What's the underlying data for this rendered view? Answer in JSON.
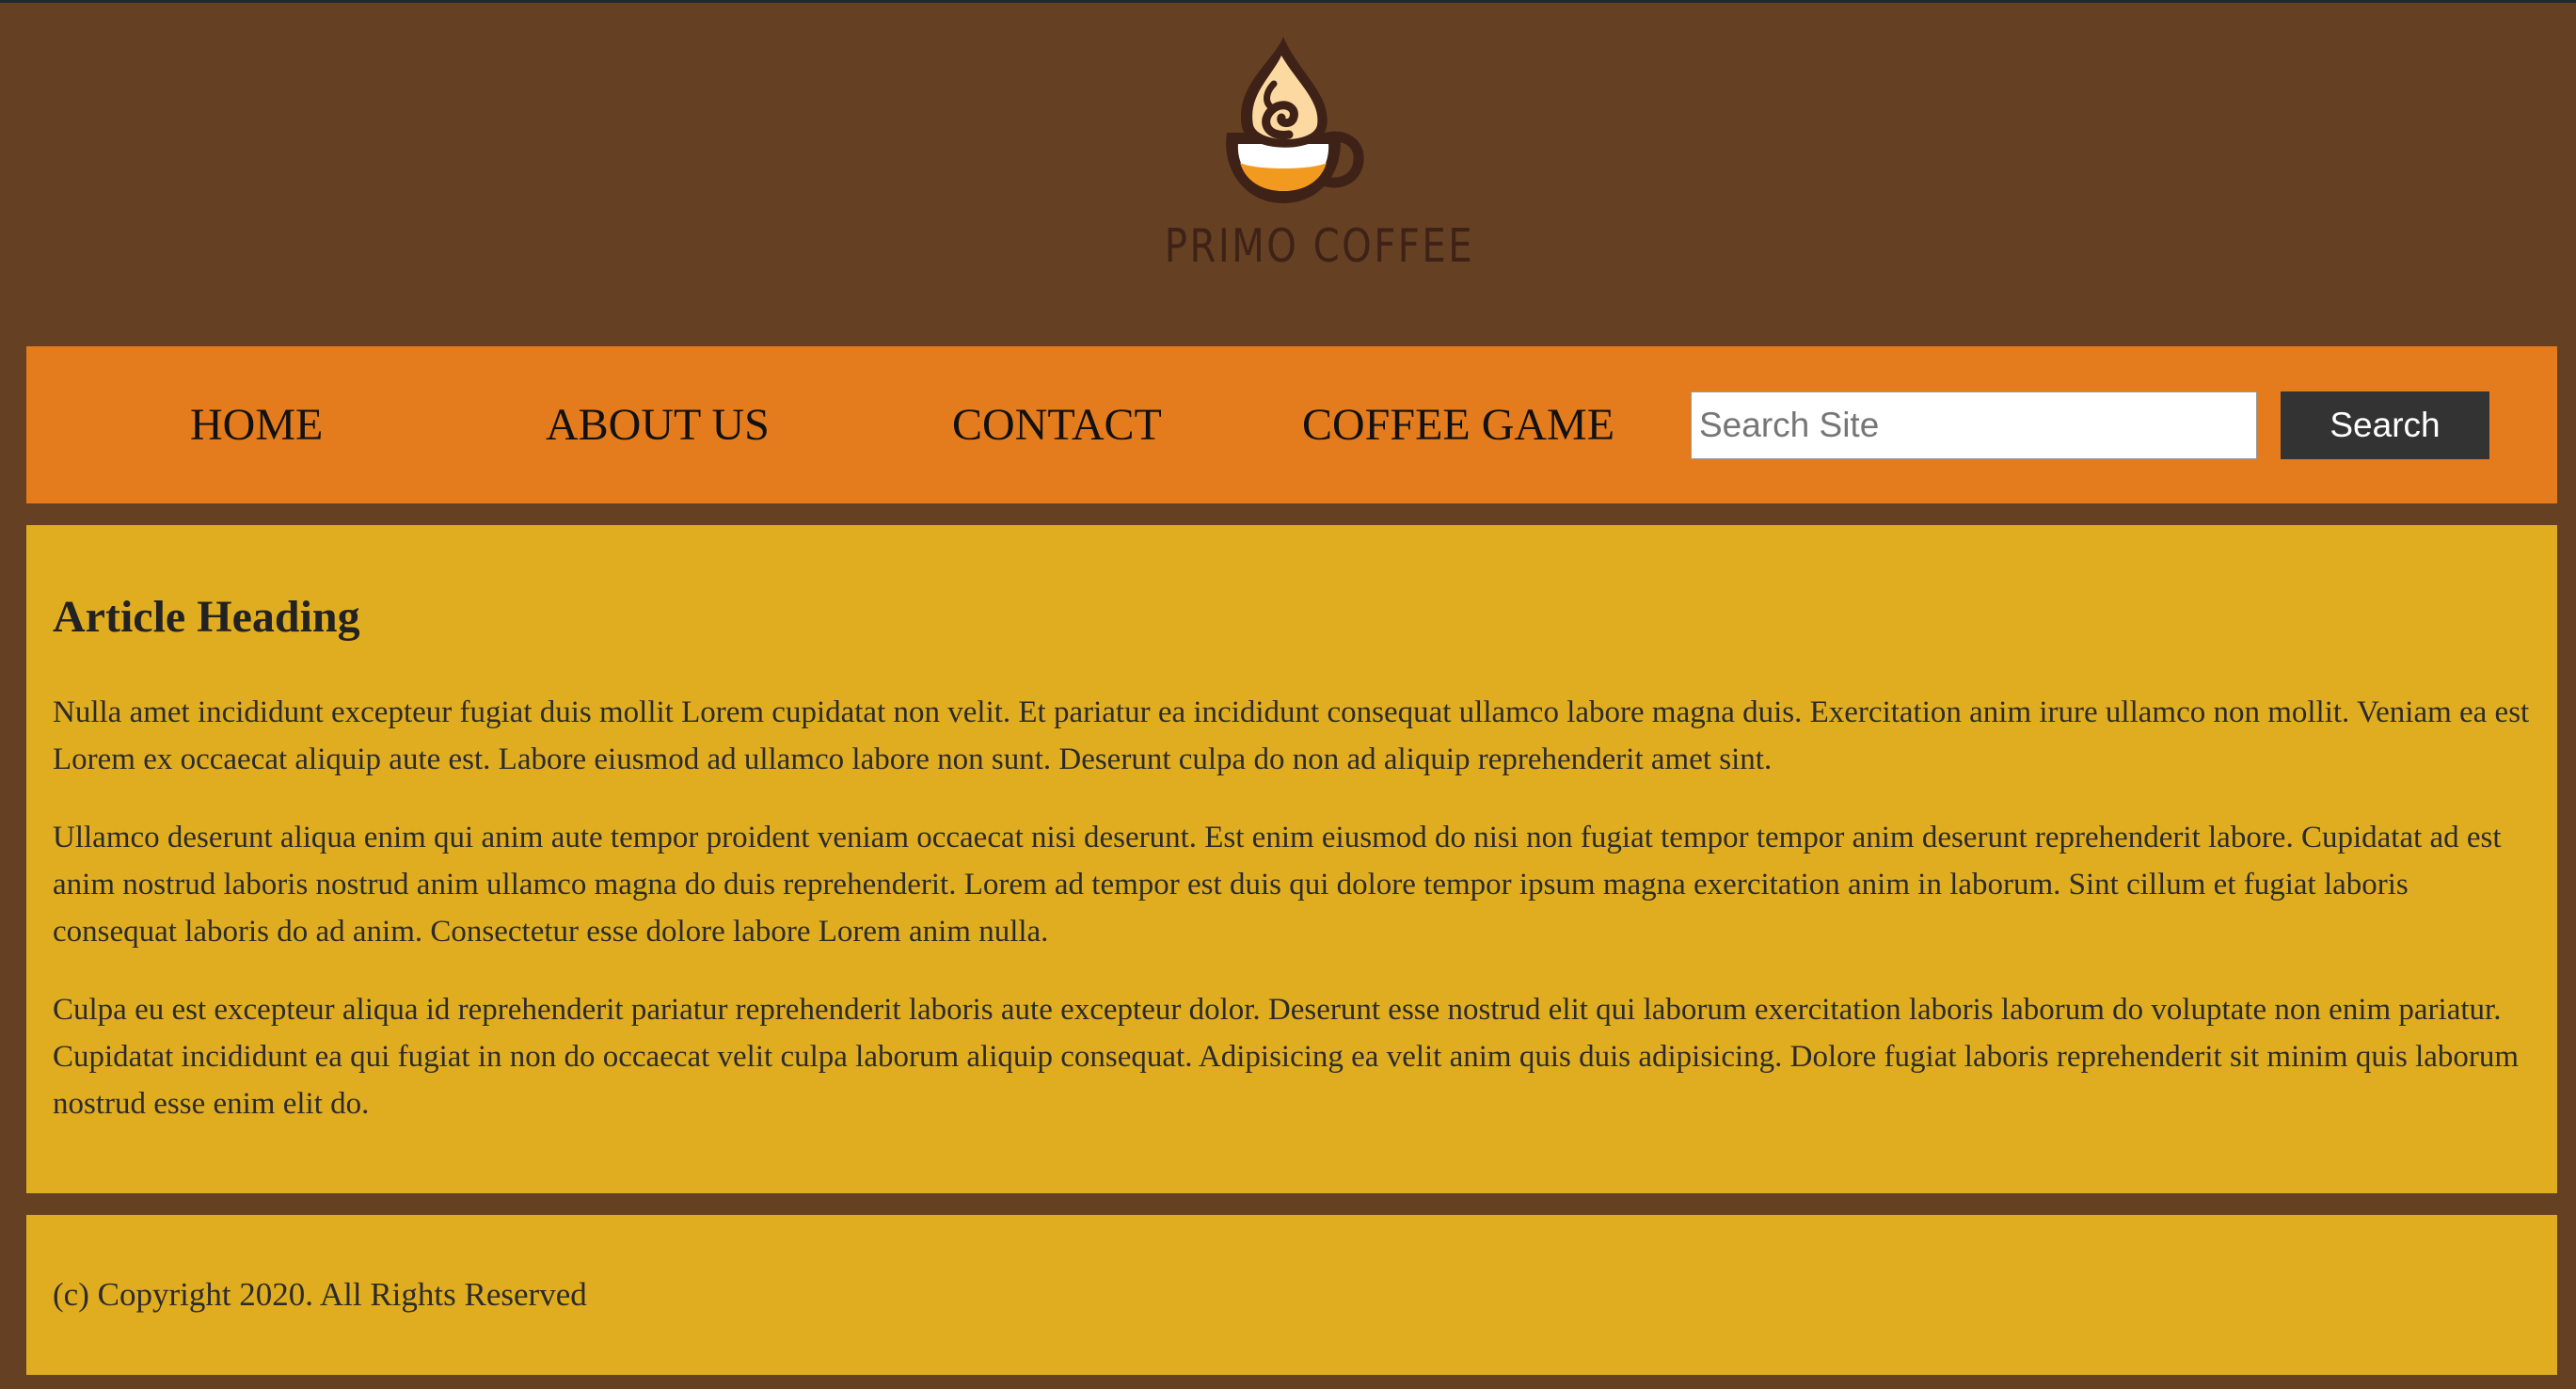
{
  "brand": {
    "name": "PRIMO COFFEE",
    "logo_icon": "coffee-cup-icon",
    "colors": {
      "cup_ring": "#3e2218",
      "coffee": "#f29a1f",
      "foam": "#fdd9a2"
    }
  },
  "nav": {
    "items": [
      {
        "label": "HOME"
      },
      {
        "label": "ABOUT US"
      },
      {
        "label": "CONTACT"
      },
      {
        "label": "COFFEE GAME"
      }
    ],
    "search": {
      "placeholder": "Search Site",
      "value": "",
      "button_label": "Search"
    }
  },
  "article": {
    "heading": "Article Heading",
    "paragraphs": [
      "Nulla amet incididunt excepteur fugiat duis mollit Lorem cupidatat non velit. Et pariatur ea incididunt consequat ullamco labore magna duis. Exercitation anim irure ullamco non mollit. Veniam ea est Lorem ex occaecat aliquip aute est. Labore eiusmod ad ullamco labore non sunt. Deserunt culpa do non ad aliquip reprehenderit amet sint.",
      "Ullamco deserunt aliqua enim qui anim aute tempor proident veniam occaecat nisi deserunt. Est enim eiusmod do nisi non fugiat tempor tempor anim deserunt reprehenderit labore. Cupidatat ad est anim nostrud laboris nostrud anim ullamco magna do duis reprehenderit. Lorem ad tempor est duis qui dolore tempor ipsum magna exercitation anim in laborum. Sint cillum et fugiat laboris consequat laboris do ad anim. Consectetur esse dolore labore Lorem anim nulla.",
      "Culpa eu est excepteur aliqua id reprehenderit pariatur reprehenderit laboris aute excepteur dolor. Deserunt esse nostrud elit qui laborum exercitation laboris laborum do voluptate non enim pariatur. Cupidatat incididunt ea qui fugiat in non do occaecat velit culpa laborum aliquip consequat. Adipisicing ea velit anim quis duis adipisicing. Dolore fugiat laboris reprehenderit sit minim quis laborum nostrud esse enim elit do."
    ]
  },
  "footer": {
    "copyright": "(c) Copyright 2020. All Rights Reserved"
  },
  "theme": {
    "page_bg": "#654022",
    "nav_bg": "#e47c1e",
    "content_bg": "#e1ad20",
    "button_bg": "#333333"
  }
}
